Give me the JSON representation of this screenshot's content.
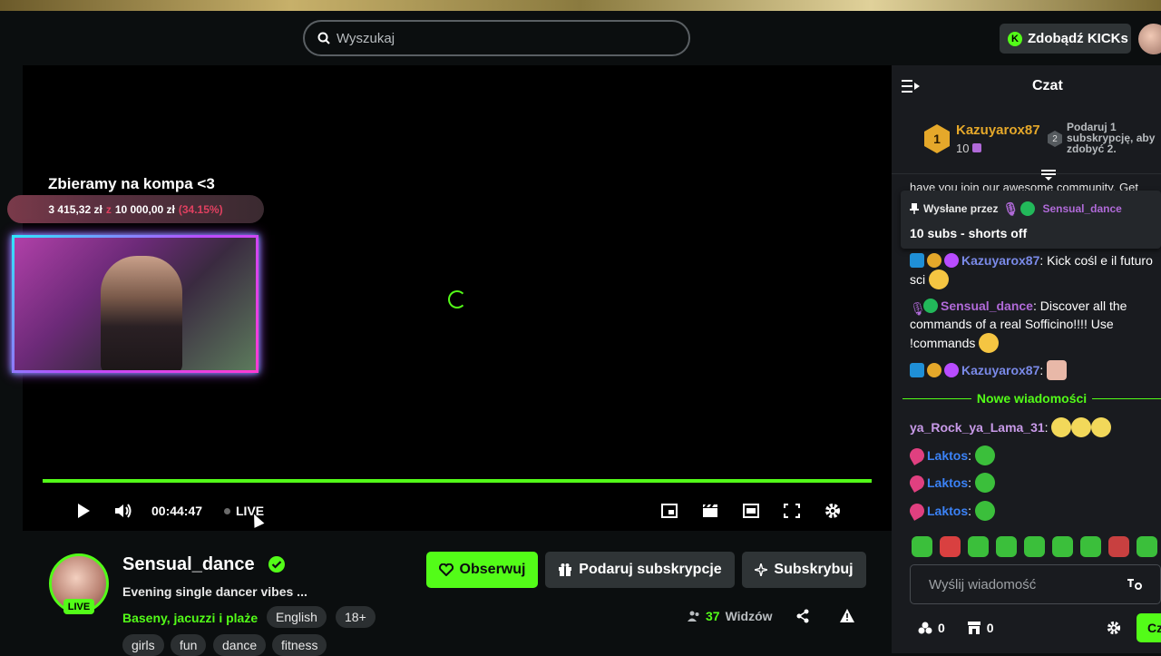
{
  "header": {
    "search_placeholder": "Wyszukaj",
    "kicks_button": "Zdobądź KICKs"
  },
  "player": {
    "goal_title": "Zbieramy na kompa <3",
    "goal_current": "3 415,32 zł",
    "goal_of": "z",
    "goal_target": "10 000,00 zł",
    "goal_percent": "(34.15%)",
    "time": "00:44:47",
    "live_label": "LIVE",
    "progress_fraction": 1.0
  },
  "channel": {
    "name": "Sensual_dance",
    "live_badge": "LIVE",
    "stream_title": "Evening  single dancer vibes ...",
    "category": "Baseny, jacuzzi i plaże",
    "tags": [
      "English",
      "18+",
      "girls",
      "fun",
      "dance",
      "fitness"
    ],
    "follow_button": "Obserwuj",
    "gift_button": "Podaruj subskrypcje",
    "subscribe_button": "Subskrybuj",
    "viewers_count": "37",
    "viewers_label": "Widzów"
  },
  "chat": {
    "title": "Czat",
    "leader": {
      "rank": "1",
      "name": "Kazuyarox87",
      "count": "10",
      "rank2": "2",
      "note": "Podaruj 1 subskrypcję, aby zdobyć 2."
    },
    "pinned_cut": "have you join our awesome community. Get",
    "pinned": {
      "by_label": "Wysłane przez",
      "by_user": "Sensual_dance",
      "message": "10 subs - shorts off"
    },
    "partial_msg_user": "Kazuyarox87",
    "partial_msg_text": ": Kick cośl e il futuro",
    "partial_msg_line2": "sci",
    "msg_dance_user": "Sensual_dance",
    "msg_dance_text": ": Discover all the commands of a real Sofficino!!!! Use !commands",
    "msg_kazu_user": "Kazuyarox87",
    "msg_kazu_text": ":",
    "new_messages": "Nowe wiadomości",
    "msg_rock_user": "ya_Rock_ya_Lama_31",
    "msg_rock_text": ":",
    "laktos_user": "Laktos",
    "laktos_sep": ":",
    "input_placeholder": "Wyślij wiadomość",
    "foot_drops": "0",
    "foot_store": "0",
    "send_button": "Czat"
  },
  "colors": {
    "accent": "#53fc18",
    "chat_bg": "#191b1f",
    "page_bg": "#0b0e0f",
    "leader_gold": "#e5a82a",
    "sub_purple": "#b06ad8"
  }
}
